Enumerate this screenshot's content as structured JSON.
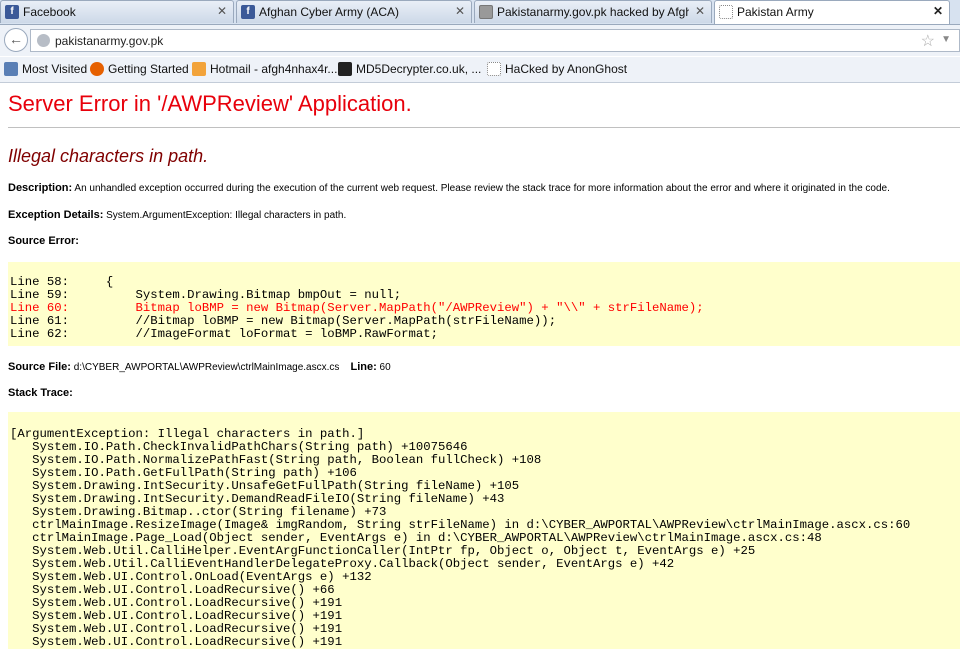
{
  "tabs": [
    {
      "label": "Facebook",
      "icon": "facebook-icon",
      "color": "#3b5998",
      "active": false
    },
    {
      "label": "Afghan Cyber Army (ACA)",
      "icon": "facebook-icon",
      "color": "#3b5998",
      "active": false
    },
    {
      "label": "Pakistanarmy.gov.pk hacked by Afgh...",
      "icon": "page-icon",
      "color": "#777777",
      "active": false
    },
    {
      "label": "Pakistan Army",
      "icon": "blank-page-icon",
      "color": "#ffffff",
      "active": true
    }
  ],
  "address_bar": {
    "url": "pakistanarmy.gov.pk"
  },
  "bookmarks": [
    {
      "label": "Most Visited",
      "icon": "bookmark-list-icon"
    },
    {
      "label": "Getting Started",
      "icon": "firefox-icon"
    },
    {
      "label": "Hotmail - afgh4nhax4r...",
      "icon": "hotmail-icon"
    },
    {
      "label": "MD5Decrypter.co.uk, ...",
      "icon": "md5-icon"
    },
    {
      "label": "HaCked by AnonGhost",
      "icon": "blank-page-icon"
    }
  ],
  "page": {
    "title": "Server Error in '/AWPReview' Application.",
    "subtitle": "Illegal characters in path.",
    "description_label": "Description:",
    "description_text": " An unhandled exception occurred during the execution of the current web request. Please review the stack trace for more information about the error and where it originated in the code.",
    "exception_label": "Exception Details:",
    "exception_text": " System.ArgumentException: Illegal characters in path.",
    "source_error_label": "Source Error:",
    "source_lines": [
      {
        "text": "Line 58:     {",
        "highlight": false
      },
      {
        "text": "Line 59:         System.Drawing.Bitmap bmpOut = null;",
        "highlight": false
      },
      {
        "text": "Line 60:         Bitmap loBMP = new Bitmap(Server.MapPath(\"/AWPReview\") + \"\\\\\" + strFileName);",
        "highlight": true
      },
      {
        "text": "Line 61:         //Bitmap loBMP = new Bitmap(Server.MapPath(strFileName));",
        "highlight": false
      },
      {
        "text": "Line 62:         //ImageFormat loFormat = loBMP.RawFormat;",
        "highlight": false
      }
    ],
    "source_file_label": "Source File:",
    "source_file_value": " d:\\CYBER_AWPORTAL\\AWPReview\\ctrlMainImage.ascx.cs",
    "line_label": "Line:",
    "line_value": " 60",
    "stack_trace_label": "Stack Trace:",
    "stack_lines": [
      "[ArgumentException: Illegal characters in path.]",
      "   System.IO.Path.CheckInvalidPathChars(String path) +10075646",
      "   System.IO.Path.NormalizePathFast(String path, Boolean fullCheck) +108",
      "   System.IO.Path.GetFullPath(String path) +106",
      "   System.Drawing.IntSecurity.UnsafeGetFullPath(String fileName) +105",
      "   System.Drawing.IntSecurity.DemandReadFileIO(String fileName) +43",
      "   System.Drawing.Bitmap..ctor(String filename) +73",
      "   ctrlMainImage.ResizeImage(Image& imgRandom, String strFileName) in d:\\CYBER_AWPORTAL\\AWPReview\\ctrlMainImage.ascx.cs:60",
      "   ctrlMainImage.Page_Load(Object sender, EventArgs e) in d:\\CYBER_AWPORTAL\\AWPReview\\ctrlMainImage.ascx.cs:48",
      "   System.Web.Util.CalliHelper.EventArgFunctionCaller(IntPtr fp, Object o, Object t, EventArgs e) +25",
      "   System.Web.Util.CalliEventHandlerDelegateProxy.Callback(Object sender, EventArgs e) +42",
      "   System.Web.UI.Control.OnLoad(EventArgs e) +132",
      "   System.Web.UI.Control.LoadRecursive() +66",
      "   System.Web.UI.Control.LoadRecursive() +191",
      "   System.Web.UI.Control.LoadRecursive() +191",
      "   System.Web.UI.Control.LoadRecursive() +191",
      "   System.Web.UI.Control.LoadRecursive() +191"
    ]
  },
  "colors": {
    "title_red": "#e8000b",
    "subtitle_maroon": "#800000",
    "code_bg": "#ffffcc",
    "highlight_line": "#ff0000"
  }
}
